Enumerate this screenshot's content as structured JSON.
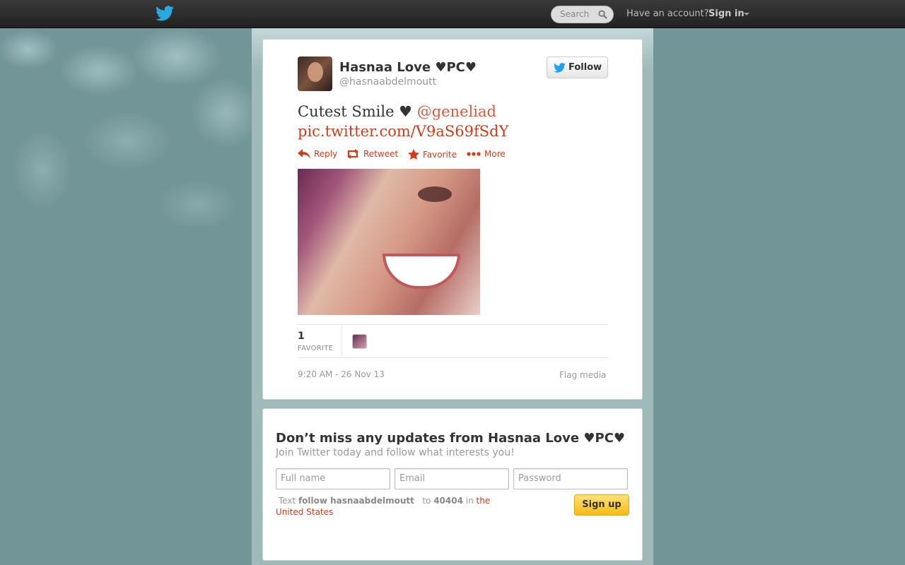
{
  "topbar": {
    "search_placeholder": "Search",
    "have_account": "Have an account?",
    "sign_in": "Sign in"
  },
  "tweet": {
    "user_name": "Hasnaa Love ♥PC♥",
    "user_handle": "@hasnaabdelmoutt",
    "follow_label": "Follow",
    "text_before": "Cutest Smile ♥ ",
    "mention": "@geneliad",
    "link": "pic.twitter.com/V9aS69fSdY",
    "actions": {
      "reply": "Reply",
      "retweet": "Retweet",
      "favorite": "Favorite",
      "more": "More"
    },
    "favorite_count": "1",
    "favorite_label": "FAVORITE",
    "timestamp": "9:20 AM - 26 Nov 13",
    "flag_media": "Flag media"
  },
  "signup": {
    "title": "Don’t miss any updates from Hasnaa Love ♥PC♥",
    "subtitle": "Join Twitter today and follow what interests you!",
    "full_name_placeholder": "Full name",
    "email_placeholder": "Email",
    "password_placeholder": "Password",
    "sms_text": "Text",
    "sms_command": "follow hasnaabdelmoutt",
    "sms_to": "to",
    "sms_number": "40404",
    "sms_in": "in",
    "sms_country": "the United States",
    "signup_label": "Sign up"
  },
  "colors": {
    "link": "#d83a14",
    "mention": "#e05a3a",
    "background": "#729597",
    "twitter_blue": "#1da1f2",
    "signup_yellow": "#f7bb14"
  },
  "icons": [
    "twitter-bird-icon",
    "search-icon",
    "reply-icon",
    "retweet-icon",
    "star-icon",
    "more-dots-icon"
  ]
}
